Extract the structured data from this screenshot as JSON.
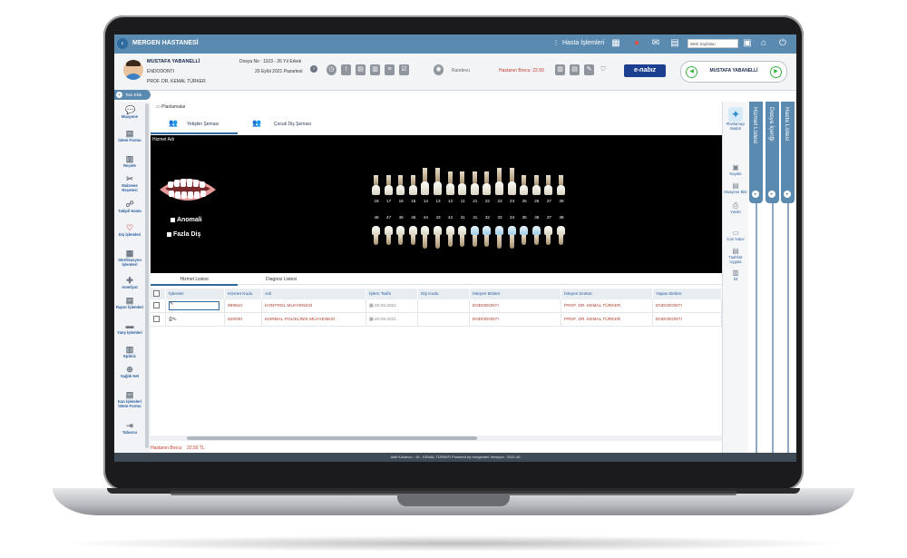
{
  "topbar": {
    "title": "MERGEN HASTANESİ",
    "hasta_islemleri": "Hasta İşlemleri",
    "web_select": "Web Sayfaları"
  },
  "patient": {
    "name": "MUSTAFA YABANELLİ",
    "department": "ENDODONTI",
    "doctor": "PROF. DR. KEMAL TÜRKER",
    "dosya": "Dosya No : 1103 - 26 Yıl Erkek",
    "tarih": "20 Eylül 2021 Pazartesi",
    "randevu": "Randevu",
    "borc": "Hastanın Borcu: 22.50",
    "nabiz": "e-nabız",
    "nav_name": "MUSTAFA YABANELLİ"
  },
  "sidebar": {
    "add_button": "Tanı Ekle",
    "items": [
      {
        "label": "Muayene",
        "icon": "chat-icon"
      },
      {
        "label": "İstem Formu",
        "icon": "form-icon"
      },
      {
        "label": "Reçete",
        "icon": "prescription-icon"
      },
      {
        "label": "Malzeme Reçetesi",
        "icon": "material-icon"
      },
      {
        "label": "Takipli Hasta",
        "icon": "followup-icon"
      },
      {
        "label": "Diş İşlemleri",
        "icon": "tooth-icon"
      },
      {
        "label": "Sterilizasyon İşlemleri",
        "icon": "sterilization-icon"
      },
      {
        "label": "Ameliyat",
        "icon": "surgery-icon"
      },
      {
        "label": "Rapor İşlemleri",
        "icon": "report-icon"
      },
      {
        "label": "Yatış İşlemleri",
        "icon": "bed-icon"
      },
      {
        "label": "Epikriz",
        "icon": "epicrisis-icon"
      },
      {
        "label": "Sağlık Net",
        "icon": "health-net-icon"
      },
      {
        "label": "Kan İşlemleri İstem Formu",
        "icon": "blood-icon"
      },
      {
        "label": "Taburcu",
        "icon": "discharge-icon"
      }
    ]
  },
  "main": {
    "breadcrumb": "Planlamalar",
    "tabs": [
      "Yetişkin Şeması",
      "Çocuk Diş Şeması"
    ],
    "chart_label": "Hizmet Adı",
    "upper_numbers": [
      "18",
      "17",
      "16",
      "15",
      "14",
      "13",
      "12",
      "11",
      "21",
      "22",
      "23",
      "24",
      "25",
      "26",
      "27",
      "28"
    ],
    "lower_numbers": [
      "48",
      "47",
      "46",
      "45",
      "44",
      "43",
      "42",
      "41",
      "31",
      "32",
      "33",
      "34",
      "35",
      "36",
      "37",
      "38"
    ],
    "legend": [
      "Anomali",
      "Fazla Diş"
    ],
    "lower_tabs": [
      "Hizmet Listesi",
      "Diagnoz Listesi"
    ],
    "table": {
      "headers": [
        "",
        "İşlemler",
        "Hizmet Kodu",
        "Adı",
        "İşlem Tarihi",
        "Diş Kodu",
        "İsteyen Bölüm",
        "İsteyen Doktor",
        "Yapan Bölüm"
      ],
      "rows": [
        {
          "code": "999910",
          "name": "KONTROL MUAYENESİ",
          "date": "20.09.2021",
          "tooth": "",
          "req_dept": "ENDODONTI",
          "req_doc": "PROF. DR. KEMAL TÜRKER",
          "dept": "ENDODONTI"
        },
        {
          "code": "520030",
          "name": "NORMAL POLİKLİNİK MUAYENESİ",
          "date": "20.09.2021",
          "tooth": "",
          "req_dept": "ENDODONTI",
          "req_doc": "PROF. DR. KEMAL TÜRKER",
          "dept": "ENDODONTI"
        }
      ]
    },
    "borc_label": "Hastanın Borcu",
    "borc_value": "22.50 TL"
  },
  "right_panel": {
    "items": [
      {
        "label": "Planlamayı Başlat",
        "icon": "start-plan-icon"
      },
      {
        "label": "Kaydet",
        "icon": "save-icon"
      },
      {
        "label": "Muayene Bitir",
        "icon": "finish-icon"
      },
      {
        "label": "Yazdır",
        "icon": "print-icon"
      },
      {
        "label": "İcon İndex",
        "icon": "icon-index-icon"
      },
      {
        "label": "Taahhüt Uygula",
        "icon": "commitment-icon"
      },
      {
        "label": "Sil",
        "icon": "delete-icon"
      }
    ],
    "vertical_tabs": [
      "Hizmet Listesi",
      "Dosya İçeriği",
      "Hasta Listesi"
    ]
  },
  "footer": "Aktif Kullanıcı : 16 - KEMAL TÜRKER    Powered by  mergentek  Versiyon : 2021.46",
  "colors": {
    "accent": "#5b8ab0",
    "debt": "#c0392b",
    "link": "#2b5e9c"
  }
}
